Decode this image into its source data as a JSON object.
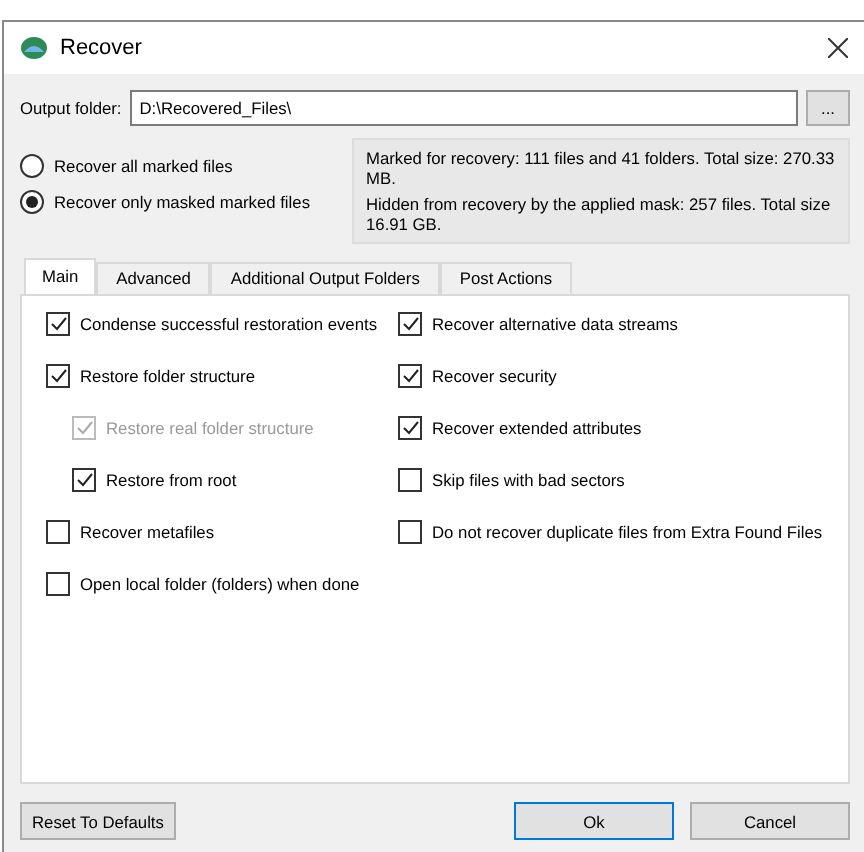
{
  "window": {
    "title": "Recover"
  },
  "output_folder": {
    "label": "Output folder:",
    "value": "D:\\Recovered_Files\\",
    "browse": "..."
  },
  "mode": [
    {
      "label": "Recover all marked files",
      "selected": false
    },
    {
      "label": "Recover only masked marked files",
      "selected": true
    }
  ],
  "info": [
    "Marked for recovery: 111 files and 41 folders. Total size: 270.33 MB.",
    "Hidden from recovery by the applied mask: 257 files. Total size 16.91 GB."
  ],
  "tabs": [
    {
      "label": "Main",
      "selected": true
    },
    {
      "label": "Advanced",
      "selected": false
    },
    {
      "label": "Additional Output Folders",
      "selected": false
    },
    {
      "label": "Post Actions",
      "selected": false
    }
  ],
  "options_left": [
    {
      "label": "Condense successful restoration events",
      "checked": true,
      "disabled": false
    },
    {
      "label": "Restore folder structure",
      "checked": true,
      "disabled": false,
      "children": [
        {
          "label": "Restore real folder structure",
          "checked": true,
          "disabled": true
        },
        {
          "label": "Restore from root",
          "checked": true,
          "disabled": false
        }
      ]
    },
    {
      "label": "Recover metafiles",
      "checked": false,
      "disabled": false
    },
    {
      "label": "Open local folder (folders) when done",
      "checked": false,
      "disabled": false
    }
  ],
  "options_right": [
    {
      "label": "Recover alternative data streams",
      "checked": true,
      "disabled": false
    },
    {
      "label": "Recover security",
      "checked": true,
      "disabled": false
    },
    {
      "label": "Recover extended attributes",
      "checked": true,
      "disabled": false
    },
    {
      "label": "Skip files with bad sectors",
      "checked": false,
      "disabled": false
    },
    {
      "label": "Do not recover duplicate files from Extra Found Files",
      "checked": false,
      "disabled": false
    }
  ],
  "buttons": {
    "reset": "Reset To Defaults",
    "ok": "Ok",
    "cancel": "Cancel"
  }
}
